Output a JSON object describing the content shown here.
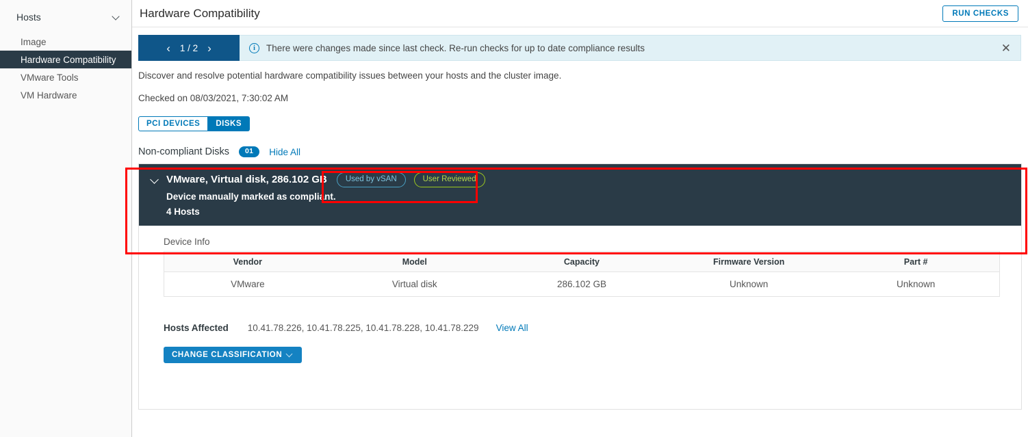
{
  "sidebar": {
    "group_label": "Hosts",
    "group_icon": "chevron-down-icon",
    "items": [
      {
        "label": "Image",
        "selected": false
      },
      {
        "label": "Hardware Compatibility",
        "selected": true
      },
      {
        "label": "VMware Tools",
        "selected": false
      },
      {
        "label": "VM Hardware",
        "selected": false
      }
    ]
  },
  "header": {
    "title": "Hardware Compatibility",
    "run_checks_label": "RUN CHECKS"
  },
  "banner": {
    "pager_prev": "‹",
    "pager_count": "1 / 2",
    "pager_next": "›",
    "info_glyph": "i",
    "text": "There were changes made since last check. Re-run checks for up to date compliance results",
    "close_glyph": "✕"
  },
  "description": "Discover and resolve potential hardware compatibility issues between your hosts and the cluster image.",
  "checked_on": "Checked on 08/03/2021, 7:30:02 AM",
  "tabs": [
    {
      "label": "PCI DEVICES",
      "active": false
    },
    {
      "label": "DISKS",
      "active": true
    }
  ],
  "noncompliant": {
    "label": "Non-compliant Disks",
    "count": "01",
    "hide_all": "Hide All"
  },
  "device": {
    "title": "VMware, Virtual disk, 286.102 GB",
    "badges": [
      {
        "label": "Used by vSAN",
        "color": "#7fc3de",
        "border": "#4aa1c4"
      },
      {
        "label": "User Reviewed",
        "color": "#b6d84a",
        "border": "#9ec91f"
      }
    ],
    "subtitle": "Device manually marked as compliant.",
    "hosts_count": "4 Hosts"
  },
  "device_info": {
    "section_label": "Device Info",
    "columns": [
      "Vendor",
      "Model",
      "Capacity",
      "Firmware Version",
      "Part #"
    ],
    "rows": [
      [
        "VMware",
        "Virtual disk",
        "286.102 GB",
        "Unknown",
        "Unknown"
      ]
    ]
  },
  "hosts_affected": {
    "label": "Hosts Affected",
    "value": "10.41.78.226, 10.41.78.225, 10.41.78.228, 10.41.78.229",
    "view_all": "View All"
  },
  "actions": {
    "change_classification": "CHANGE CLASSIFICATION"
  },
  "colors": {
    "accent_blue": "#0079b8",
    "pager_blue": "#0f5689",
    "banner_bg": "#e1f1f6",
    "dark_panel": "#2a3b47",
    "highlight_red": "#ff0000",
    "primary_button": "#1482c2"
  }
}
